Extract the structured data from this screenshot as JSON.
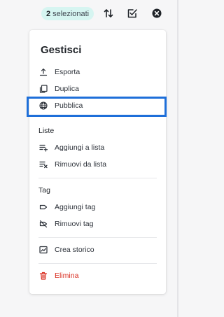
{
  "header": {
    "selection_count": "2",
    "selection_suffix": "selezionati",
    "icons": [
      "sort-icon",
      "checklist-icon",
      "close-icon"
    ]
  },
  "menu": {
    "title": "Gestisci",
    "actions": [
      {
        "label": "Esporta",
        "icon": "upload-icon"
      },
      {
        "label": "Duplica",
        "icon": "copy-icon"
      },
      {
        "label": "Pubblica",
        "icon": "globe-icon"
      }
    ],
    "lists": {
      "label": "Liste",
      "items": [
        {
          "label": "Aggiungi a lista",
          "icon": "list-add-icon"
        },
        {
          "label": "Rimuovi da lista",
          "icon": "list-remove-icon"
        }
      ]
    },
    "tags": {
      "label": "Tag",
      "items": [
        {
          "label": "Aggiungi tag",
          "icon": "tag-icon"
        },
        {
          "label": "Rimuovi tag",
          "icon": "tag-off-icon"
        }
      ]
    },
    "history": {
      "label": "Crea storico",
      "icon": "chart-icon"
    },
    "delete": {
      "label": "Elimina",
      "icon": "trash-icon"
    }
  },
  "colors": {
    "badge_bg": "#d6f5f1",
    "highlight": "#1e6fd9",
    "danger": "#d92d20"
  }
}
